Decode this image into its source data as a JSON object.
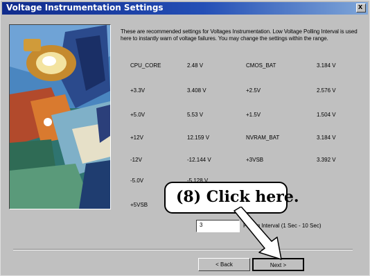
{
  "window": {
    "title": "Voltage Instrumentation Settings",
    "close_glyph": "x"
  },
  "description": "These are recommended settings for Voltages Instrumentation. Low Voltage Polling Interval is used here to instantly warn of voltage failures. You may change the settings within the range.",
  "voltages": [
    {
      "label": "CPU_CORE",
      "value": "2.48 V"
    },
    {
      "label": "CMOS_BAT",
      "value": "3.184 V"
    },
    {
      "label": "+3.3V",
      "value": "3.408 V"
    },
    {
      "label": "+2.5V",
      "value": "2.576 V"
    },
    {
      "label": "+5.0V",
      "value": "5.53 V"
    },
    {
      "label": "+1.5V",
      "value": "1.504 V"
    },
    {
      "label": "+12V",
      "value": "12.159 V"
    },
    {
      "label": "NVRAM_BAT",
      "value": "3.184 V"
    },
    {
      "label": "-12V",
      "value": "-12.144 V"
    },
    {
      "label": "+3VSB",
      "value": "3.392 V"
    },
    {
      "label": "-5.0V",
      "value": "-5.128 V"
    },
    {
      "label": "+5VSB",
      "value": ""
    }
  ],
  "callout": "(8)  Click here.",
  "polling": {
    "value": "3",
    "label": "Polling Interval (1 Sec - 10 Sec)"
  },
  "buttons": {
    "back": "< Back",
    "next": "Next >"
  }
}
